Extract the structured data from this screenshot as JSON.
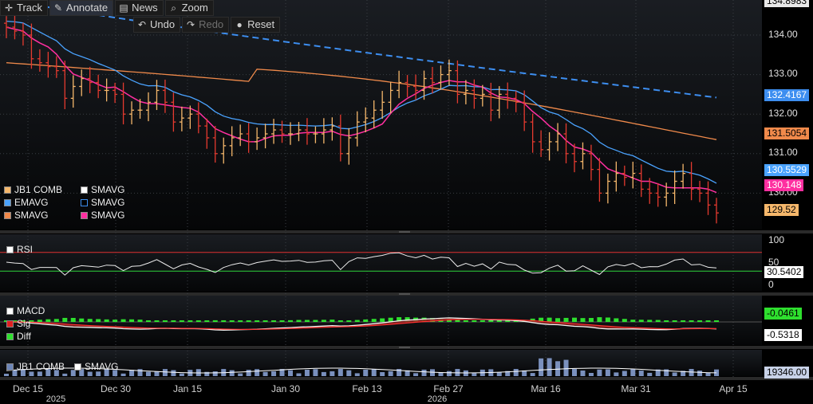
{
  "toolbar": {
    "track": "Track",
    "annotate": "Annotate",
    "news": "News",
    "zoom": "Zoom",
    "undo": "Undo",
    "redo": "Redo",
    "reset": "Reset"
  },
  "colors": {
    "up_bar": "#f5b76b",
    "down_bar": "#e53a2f",
    "ema": "#4aa3ff",
    "sma_orange": "#f08a4b",
    "sma_pink": "#ff2fa0",
    "sma_dashed": "#3d8ef0",
    "rsi_upper": "#e03030",
    "rsi_lower": "#2ed33a",
    "macd_fill": "#8c1f1f",
    "diff": "#2ee02e"
  },
  "price_legend": {
    "items": [
      {
        "label": "JB1 COMB",
        "swatch": "#f5b76b"
      },
      {
        "label": "SMAVG",
        "swatch": "#ffffff"
      },
      {
        "label": "EMAVG",
        "swatch": "#4aa3ff"
      },
      {
        "label": "SMAVG",
        "swatch": "#3d8ef0"
      },
      {
        "label": "SMAVG",
        "swatch": "#f08a4b"
      },
      {
        "label": "SMAVG",
        "swatch": "#ff2fa0"
      }
    ]
  },
  "rsi_legend": {
    "label": "RSI"
  },
  "macd_legend": {
    "macd": "MACD",
    "sig": "Sig",
    "diff": "Diff"
  },
  "volume_legend": {
    "a": "JB1 COMB",
    "b": "SMAVG"
  },
  "price_tags": {
    "top": "134.8983",
    "dashed": "132.4167",
    "orange": "131.5054",
    "ema": "130.5529",
    "pink": "130.148",
    "last": "129.52",
    "rsi": "30.5402",
    "macd": "-0.0461",
    "sig": "-0.5318",
    "volume": "19346.00"
  },
  "chart_data": [
    {
      "type": "line",
      "series_kind": "ohlc-bars",
      "x_ticks": [
        "Dec 15",
        "Dec 30",
        "Jan 15",
        "Jan 30",
        "Feb 13",
        "Feb 27",
        "Mar 16",
        "Mar 31",
        "Apr 15"
      ],
      "x_years": [
        "2025",
        "2026"
      ],
      "y_ticks": [
        "134.00",
        "133.00",
        "132.00",
        "131.00",
        "130.00"
      ],
      "y_tick_values": [
        134,
        133,
        132,
        131,
        130
      ],
      "ylim": [
        129.2,
        135.0
      ],
      "closes": [
        134.2,
        134.1,
        134.0,
        133.4,
        133.3,
        133.2,
        133.1,
        132.4,
        132.7,
        132.9,
        132.8,
        132.6,
        132.6,
        132.5,
        132.0,
        132.1,
        132.1,
        132.3,
        132.6,
        132.3,
        131.8,
        131.9,
        132.0,
        131.7,
        131.4,
        131.0,
        131.2,
        131.4,
        131.5,
        131.3,
        131.4,
        131.5,
        131.6,
        131.5,
        131.5,
        131.6,
        131.5,
        131.5,
        131.6,
        131.7,
        131.0,
        131.4,
        131.8,
        131.9,
        132.1,
        132.3,
        132.6,
        132.8,
        132.7,
        132.6,
        132.9,
        132.8,
        133.0,
        133.1,
        132.5,
        132.6,
        132.4,
        132.5,
        132.1,
        132.5,
        132.4,
        132.3,
        131.8,
        131.3,
        131.1,
        131.3,
        131.5,
        131.0,
        130.8,
        131.0,
        130.6,
        130.0,
        130.3,
        130.5,
        130.4,
        130.5,
        130.1,
        130.0,
        129.9,
        130.0,
        130.3,
        130.5,
        130.1,
        130.0,
        129.7,
        129.5
      ],
      "series": [
        {
          "name": "SMAVG",
          "values_start": 134.9,
          "values_end": 132.42
        },
        {
          "name": "SMAVG",
          "values_start": 133.3,
          "values_end": 131.51
        },
        {
          "name": "EMAVG",
          "values_start": 134.2,
          "values_end": 130.55
        },
        {
          "name": "SMAVG",
          "values_start": 133.9,
          "values_end": 130.15
        }
      ],
      "last_price": 129.52
    },
    {
      "type": "line",
      "name": "RSI",
      "y_ticks": [
        "100",
        "50",
        "0"
      ],
      "upper_line": 70,
      "lower_line": 30,
      "last": 30.5402
    },
    {
      "type": "area",
      "name": "MACD",
      "series": [
        {
          "name": "MACD",
          "last": -0.0461
        },
        {
          "name": "Sig",
          "last": -0.5318
        }
      ]
    },
    {
      "type": "bar",
      "name": "Volume",
      "last": 19346.0
    }
  ]
}
